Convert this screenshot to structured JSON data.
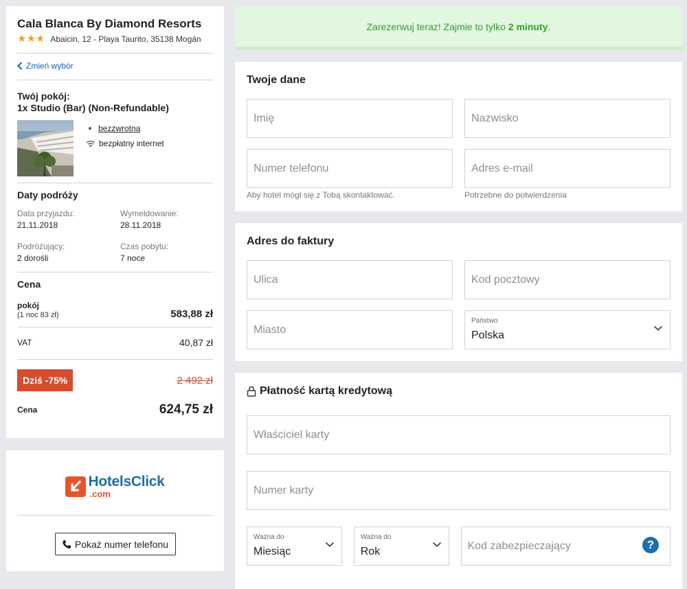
{
  "hotel": {
    "name": "Cala Blanca By Diamond Resorts",
    "stars": "★★★",
    "address": "Abaicin, 12 - Playa Taurito, 35138 Mogán",
    "change_link": "Zmień wybór",
    "room_title_line1": "Twój pokój:",
    "room_title_line2": "1x Studio (Bar) (Non-Refundable)",
    "amenities": [
      "bezzwrotna",
      "bezpłatny internet"
    ]
  },
  "dates": {
    "title": "Daty podróży",
    "checkin_label": "Data przyjazdu:",
    "checkin": "21.11.2018",
    "checkout_label": "Wymeldowanie:",
    "checkout": "28.11.2018",
    "travelers_label": "Podróżujący:",
    "travelers": "2 dorośli",
    "stay_label": "Czas pobytu:",
    "stay": "7 noce"
  },
  "price": {
    "title": "Cena",
    "room_label": "pokój",
    "room_sub": "(1 noc 83 zł)",
    "room_amount": "583,88 zł",
    "vat_label": "VAT",
    "vat_amount": "40,87 zł",
    "discount_badge": "Dziś -75%",
    "old_price": "2 492 zł",
    "total_label": "Cena",
    "total_amount": "624,75 zł"
  },
  "brand": {
    "logo_main": "HotelsClick",
    "logo_sub": ".com",
    "phone_button": "Pokaż numer telefonu"
  },
  "banner": {
    "text": "Zarezerwuj teraz! Zajmie to tylko",
    "bold": "2 minuty",
    "tail": "."
  },
  "personal": {
    "title": "Twoje dane",
    "first_name_placeholder": "Imię",
    "last_name_placeholder": "Nazwisko",
    "phone_placeholder": "Numer telefonu",
    "email_placeholder": "Adres e-mail",
    "phone_hint": "Aby hotel mógł się z Tobą skontaktować.",
    "email_hint": "Potrzebne do potwierdzenia"
  },
  "billing": {
    "title": "Adres do faktury",
    "street_placeholder": "Ulica",
    "zip_placeholder": "Kod pocztowy",
    "city_placeholder": "Miasto",
    "country_label": "Państwo",
    "country_value": "Polska"
  },
  "payment": {
    "title": "Płatność kartą kredytową",
    "holder_placeholder": "Właściciel karty",
    "number_placeholder": "Numer karty",
    "month_label": "Ważna do",
    "month_value": "Miesiąc",
    "year_label": "Ważna do",
    "year_value": "Rok",
    "cvv_placeholder": "Kod zabezpieczający",
    "help_glyph": "?"
  },
  "colors": {
    "accent_blue": "#1a5fb4",
    "discount_red": "#d64c2f",
    "success_green": "#2ea02b",
    "brand_orange": "#e8542a",
    "brand_blue": "#1e6fa0"
  }
}
